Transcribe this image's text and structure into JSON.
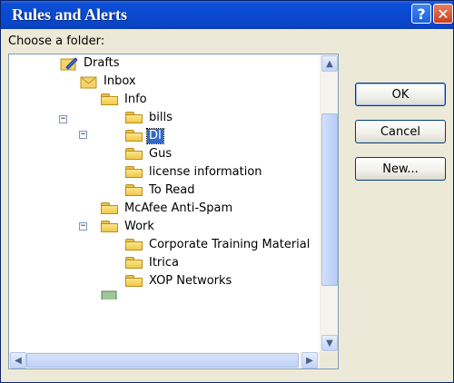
{
  "window": {
    "title": "Rules and Alerts",
    "help_glyph": "?",
    "close_glyph": "✕"
  },
  "dialog": {
    "prompt": "Choose a folder:",
    "buttons": {
      "ok": "OK",
      "cancel": "Cancel",
      "new": "New..."
    }
  },
  "tree": {
    "items": [
      {
        "label": "Drafts",
        "level": 1,
        "expander": "",
        "selected": false,
        "icon": "drafts-icon"
      },
      {
        "label": "Inbox",
        "level": 1,
        "expander": "−",
        "selected": false,
        "icon": "inbox-icon"
      },
      {
        "label": "Info",
        "level": 2,
        "expander": "−",
        "selected": false,
        "icon": "folder-icon"
      },
      {
        "label": "bills",
        "level": 3,
        "expander": "",
        "selected": false,
        "icon": "folder-icon"
      },
      {
        "label": "DI",
        "level": 3,
        "expander": "",
        "selected": true,
        "icon": "folder-icon"
      },
      {
        "label": "Gus",
        "level": 3,
        "expander": "",
        "selected": false,
        "icon": "folder-icon"
      },
      {
        "label": "license information",
        "level": 3,
        "expander": "",
        "selected": false,
        "icon": "folder-icon"
      },
      {
        "label": "To Read",
        "level": 3,
        "expander": "",
        "selected": false,
        "icon": "folder-icon"
      },
      {
        "label": "McAfee Anti-Spam",
        "level": 2,
        "expander": "",
        "selected": false,
        "icon": "folder-icon"
      },
      {
        "label": "Work",
        "level": 2,
        "expander": "−",
        "selected": false,
        "icon": "folder-icon"
      },
      {
        "label": "Corporate Training Material",
        "level": 3,
        "expander": "",
        "selected": false,
        "icon": "folder-icon"
      },
      {
        "label": "Itrica",
        "level": 3,
        "expander": "",
        "selected": false,
        "icon": "folder-icon"
      },
      {
        "label": "XOP Networks",
        "level": 3,
        "expander": "",
        "selected": false,
        "icon": "folder-icon"
      }
    ]
  },
  "scroll": {
    "up": "▲",
    "down": "▼",
    "left": "◀",
    "right": "▶"
  }
}
